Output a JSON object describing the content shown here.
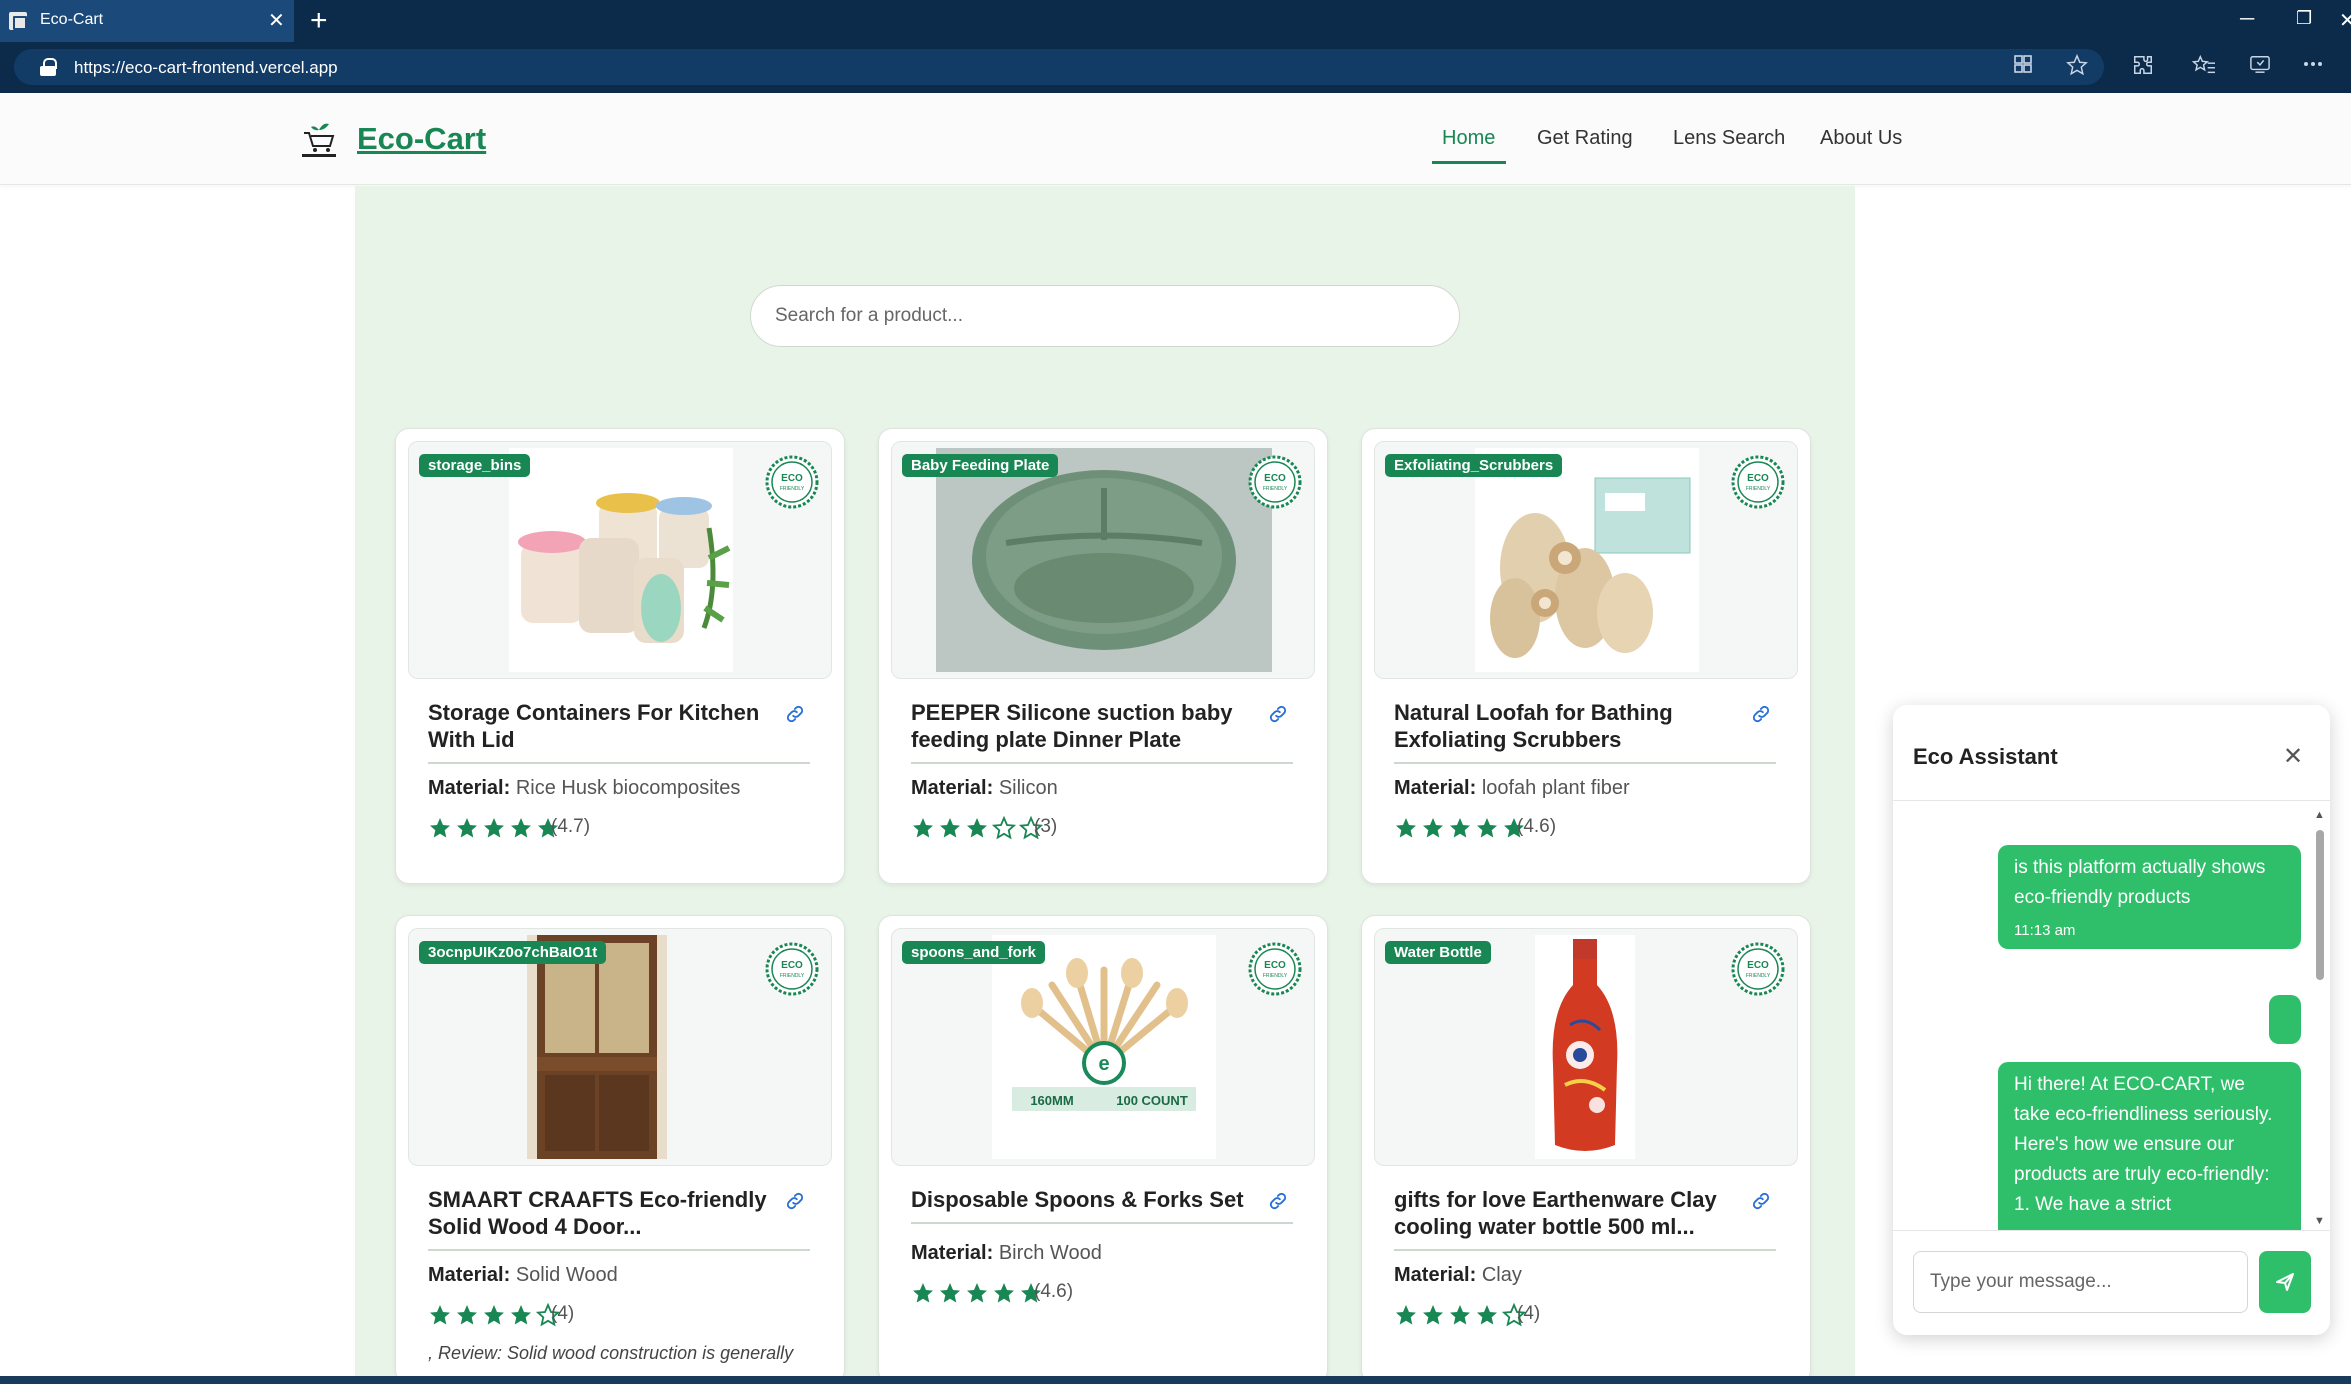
{
  "browser": {
    "tab_title": "Eco-Cart",
    "tab_close": "✕",
    "new_tab": "+",
    "url": "https://eco-cart-frontend.vercel.app",
    "window_min": "─",
    "window_max": "❐",
    "window_close": "✕"
  },
  "header": {
    "brand": "Eco-Cart",
    "nav": [
      {
        "label": "Home",
        "active": true
      },
      {
        "label": "Get Rating",
        "active": false
      },
      {
        "label": "Lens Search",
        "active": false
      },
      {
        "label": "About Us",
        "active": false
      }
    ]
  },
  "search": {
    "placeholder": "Search for a product..."
  },
  "products": [
    {
      "category": "storage_bins",
      "title": "Storage Containers For Kitchen With Lid",
      "material_label": "Material:",
      "material": "Rice Husk biocomposites",
      "rating": 4.7,
      "rating_text": "(4.7)"
    },
    {
      "category": "Baby Feeding Plate",
      "title": "PEEPER Silicone suction baby feeding plate Dinner Plate",
      "material_label": "Material:",
      "material": "Silicon",
      "rating": 3,
      "rating_text": "(3)"
    },
    {
      "category": "Exfoliating_Scrubbers",
      "title": "Natural Loofah for Bathing Exfoliating Scrubbers",
      "material_label": "Material:",
      "material": "loofah plant fiber",
      "rating": 4.6,
      "rating_text": "(4.6)"
    },
    {
      "category": "3ocnpUIKz0o7chBaIO1t",
      "title": "SMAART CRAAFTS Eco-friendly Solid Wood 4 Door...",
      "material_label": "Material:",
      "material": "Solid Wood",
      "rating": 4,
      "rating_text": "(4)",
      "review": ", Review: Solid wood construction is generally"
    },
    {
      "category": "spoons_and_fork",
      "title": "Disposable Spoons & Forks Set",
      "material_label": "Material:",
      "material": "Birch Wood",
      "rating": 4.6,
      "rating_text": "(4.6)"
    },
    {
      "category": "Water Bottle",
      "title": "gifts for love Earthenware Clay cooling water bottle 500 ml...",
      "material_label": "Material:",
      "material": "Clay",
      "rating": 4,
      "rating_text": "(4)"
    }
  ],
  "image_labels": {
    "fork_label_left": "160MM",
    "fork_label_right": "100 COUNT"
  },
  "chat": {
    "title": "Eco Assistant",
    "close": "✕",
    "messages": [
      {
        "text": "is this platform actually shows eco-friendly products",
        "time": "11:13 am"
      },
      {
        "text": "",
        "time": ""
      },
      {
        "text": "Hi there! At ECO-CART, we take eco-friendliness seriously. Here's how we ensure our products are truly eco-friendly: 1. We have a strict",
        "time": ""
      }
    ],
    "input_placeholder": "Type your message..."
  },
  "colors": {
    "brand_green": "#198754",
    "chat_green": "#2fbf6b",
    "page_bg": "#e8f4e8",
    "chrome_dark": "#0c2a4a"
  }
}
